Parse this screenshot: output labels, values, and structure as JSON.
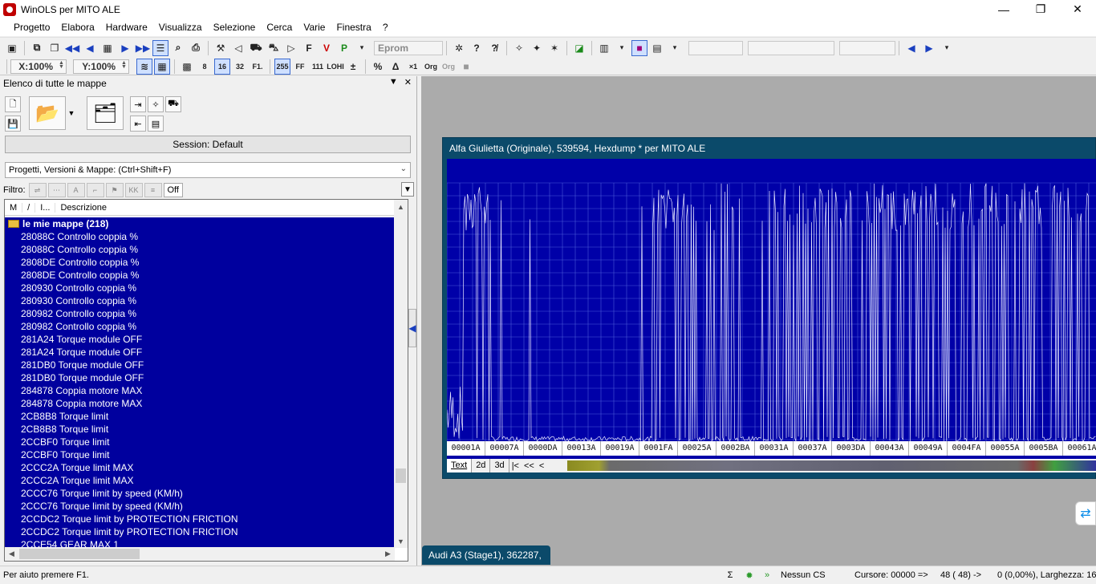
{
  "window": {
    "title": "WinOLS per MITO ALE",
    "minimize": "—",
    "maximize": "❐",
    "close": "✕"
  },
  "menu": [
    "Progetto",
    "Elabora",
    "Hardware",
    "Visualizza",
    "Selezione",
    "Cerca",
    "Varie",
    "Finestra",
    "?"
  ],
  "toolbar": {
    "eprom_label": "Eprom",
    "zoom_x": "X:100%",
    "zoom_y": "Y:100%",
    "bits_8": "8",
    "bits_16": "16",
    "bits_32": "32",
    "bits_f": "F1.",
    "num_255": "255",
    "num_ff": "FF",
    "num_111": "111",
    "lohi": "LOHI",
    "percent": "%",
    "x1": "×1",
    "org": "Org",
    "org2": "Org"
  },
  "left_panel": {
    "title": "Elenco di tutte le mappe",
    "session_label": "Session: Default",
    "project_combo": "Progetti, Versioni & Mappe: (Ctrl+Shift+F)",
    "filter_label": "Filtro:",
    "filter_off": "Off",
    "columns": [
      "M",
      "/",
      "I...",
      "Descrizione"
    ],
    "folder": "le mie mappe (218)",
    "maps": [
      "28088C  Controllo coppia %",
      "28088C  Controllo coppia %",
      "2808DE  Controllo coppia %",
      "2808DE  Controllo coppia %",
      "280930  Controllo coppia %",
      "280930  Controllo coppia %",
      "280982  Controllo coppia %",
      "280982  Controllo coppia %",
      "281A24  Torque module OFF",
      "281A24  Torque module OFF",
      "281DB0  Torque module OFF",
      "281DB0  Torque module OFF",
      "284878  Coppia motore MAX",
      "284878  Coppia motore MAX",
      "2CB8B8  Torque limit",
      "2CB8B8  Torque limit",
      "2CCBF0  Torque limit",
      "2CCBF0  Torque limit",
      "2CCC2A  Torque limit MAX",
      "2CCC2A  Torque limit MAX",
      "2CCC76  Torque limit by speed (KM/h)",
      "2CCC76  Torque limit by speed (KM/h)",
      "2CCDC2  Torque limit by PROTECTION FRICTION",
      "2CCDC2  Torque limit by PROTECTION FRICTION",
      "2CCE54  GEAR MAX 1"
    ]
  },
  "hexdump": {
    "title": "Alfa Giulietta (Originale), 539594, Hexdump * per MITO ALE",
    "addresses": [
      "00001A",
      "00007A",
      "0000DA",
      "00013A",
      "00019A",
      "0001FA",
      "00025A",
      "0002BA",
      "00031A",
      "00037A",
      "0003DA",
      "00043A",
      "00049A",
      "0004FA",
      "00055A",
      "0005BA",
      "00061A"
    ],
    "tabs": [
      "Text",
      "2d",
      "3d"
    ],
    "nav": [
      "|<",
      "<<",
      "<"
    ],
    "colors": {
      "plot_bg": "#0000a8",
      "window_frame": "#0b4a6a",
      "list_bg": "#00009e"
    }
  },
  "minimized_window": "Audi A3 (Stage1), 362287,",
  "status": {
    "help": "Per aiuto premere F1.",
    "cs": "Nessun CS",
    "cursor": "Cursore: 00000 =>",
    "value": "48 (   48) ->",
    "width": "0 (0,00%), Larghezza: 16"
  }
}
